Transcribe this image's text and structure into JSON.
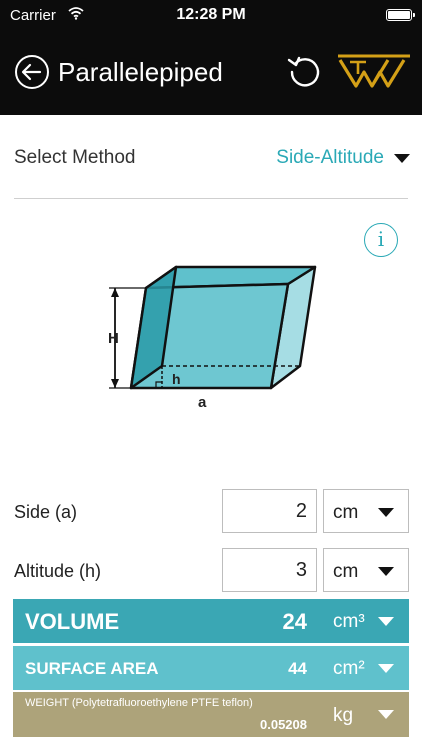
{
  "status": {
    "carrier": "Carrier",
    "time": "12:28 PM"
  },
  "nav": {
    "title": "Parallelepiped"
  },
  "method": {
    "label": "Select Method",
    "value": "Side-Altitude"
  },
  "info": {
    "glyph": "i"
  },
  "diagram": {
    "label_height": "H",
    "label_altitude": "h",
    "label_side": "a"
  },
  "inputs": [
    {
      "label": "Side (a)",
      "value": "2",
      "unit": "cm"
    },
    {
      "label": "Altitude (h)",
      "value": "3",
      "unit": "cm"
    }
  ],
  "results": {
    "volume": {
      "label": "VOLUME",
      "value": "24",
      "unit": "cm³"
    },
    "surface_area": {
      "label": "SURFACE AREA",
      "value": "44",
      "unit": "cm²"
    },
    "weight": {
      "label": "WEIGHT (Polytetrafluoroethylene PTFE teflon)",
      "value": "0.05208",
      "unit": "kg"
    }
  },
  "colors": {
    "header_bg": "#0c0c0c",
    "accent": "#2aa9b6",
    "volume_bg": "#3aa7b4",
    "surface_bg": "#5fc1cc",
    "weight_bg": "#ada37a",
    "logo": "#d4a017"
  },
  "icons": {
    "back": "back-arrow-circle-icon",
    "reset": "reset-icon",
    "logo": "brand-logo-icon",
    "dropdown": "chevron-down-icon",
    "info": "info-icon"
  }
}
